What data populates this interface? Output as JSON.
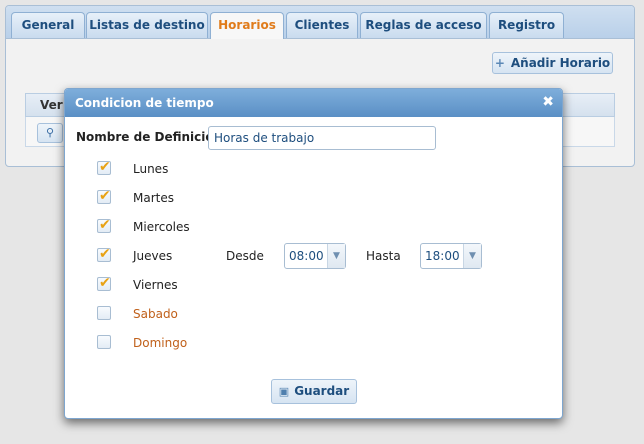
{
  "tabs": [
    {
      "label": "General",
      "active": false
    },
    {
      "label": "Listas de destino",
      "active": false
    },
    {
      "label": "Horarios",
      "active": true
    },
    {
      "label": "Clientes",
      "active": false
    },
    {
      "label": "Reglas de acceso",
      "active": false
    },
    {
      "label": "Registro",
      "active": false
    }
  ],
  "toolbar": {
    "add_schedule_label": "Añadir Horario"
  },
  "grid": {
    "first_column_header": "Ver"
  },
  "dialog": {
    "title": "Condicion de tiempo",
    "definition_label": "Nombre de Definicion:",
    "definition_value": "Horas de trabajo",
    "days": [
      {
        "label": "Lunes",
        "checked": true
      },
      {
        "label": "Martes",
        "checked": true
      },
      {
        "label": "Miercoles",
        "checked": true
      },
      {
        "label": "Jueves",
        "checked": true
      },
      {
        "label": "Viernes",
        "checked": true
      },
      {
        "label": "Sabado",
        "checked": false
      },
      {
        "label": "Domingo",
        "checked": false
      }
    ],
    "from_label": "Desde",
    "from_value": "08:00",
    "to_label": "Hasta",
    "to_value": "18:00",
    "save_label": "Guardar"
  },
  "colors": {
    "accent": "#e07b1a",
    "title_bar": "#6a9fd2",
    "check": "#e8a214",
    "inactive_day": "#c0601a"
  }
}
